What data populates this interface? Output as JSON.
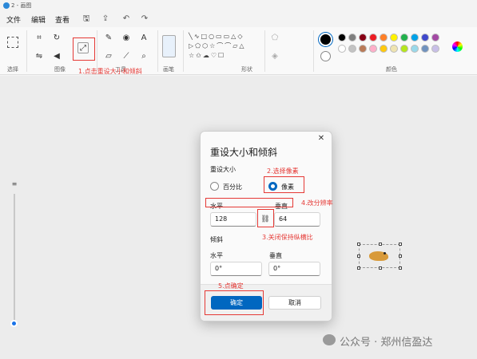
{
  "window": {
    "title": "2 - 画图"
  },
  "menu": {
    "file": "文件",
    "edit": "编辑",
    "view": "查看"
  },
  "ribbon": {
    "groups": {
      "select": "选择",
      "image": "图像",
      "tools": "工具",
      "brush": "画笔",
      "shapes": "形状",
      "colors": "颜色"
    }
  },
  "dialog": {
    "title": "重设大小和倾斜",
    "resize_label": "重设大小",
    "percent_label": "百分比",
    "pixels_label": "像素",
    "horizontal_label": "水平",
    "vertical_label": "垂直",
    "width_value": "128",
    "height_value": "64",
    "skew_label": "倾斜",
    "skew_horizontal_label": "水平",
    "skew_vertical_label": "垂直",
    "skew_h_value": "0°",
    "skew_v_value": "0°",
    "ok_label": "确定",
    "cancel_label": "取消",
    "selected_unit": "pixels"
  },
  "annotations": {
    "step1": "1.点击重设大小和倾斜",
    "step2": "2.选择像素",
    "step3": "3.关闭保持纵横比",
    "step4": "4.改分辨率",
    "step5": "5.点确定"
  },
  "watermark": "公众号 · 郑州信盈达",
  "palette": [
    "#000000",
    "#7f7f7f",
    "#880015",
    "#ed1c24",
    "#ff7f27",
    "#fff200",
    "#22b14c",
    "#00a2e8",
    "#3f48cc",
    "#a349a4",
    "#ffffff",
    "#c3c3c3",
    "#b97a57",
    "#ffaec9",
    "#ffc90e",
    "#efe4b0",
    "#b5e61d",
    "#99d9ea",
    "#7092be",
    "#c8bfe7"
  ],
  "colors": {
    "accent": "#0067c0",
    "annotation": "#e53935"
  }
}
